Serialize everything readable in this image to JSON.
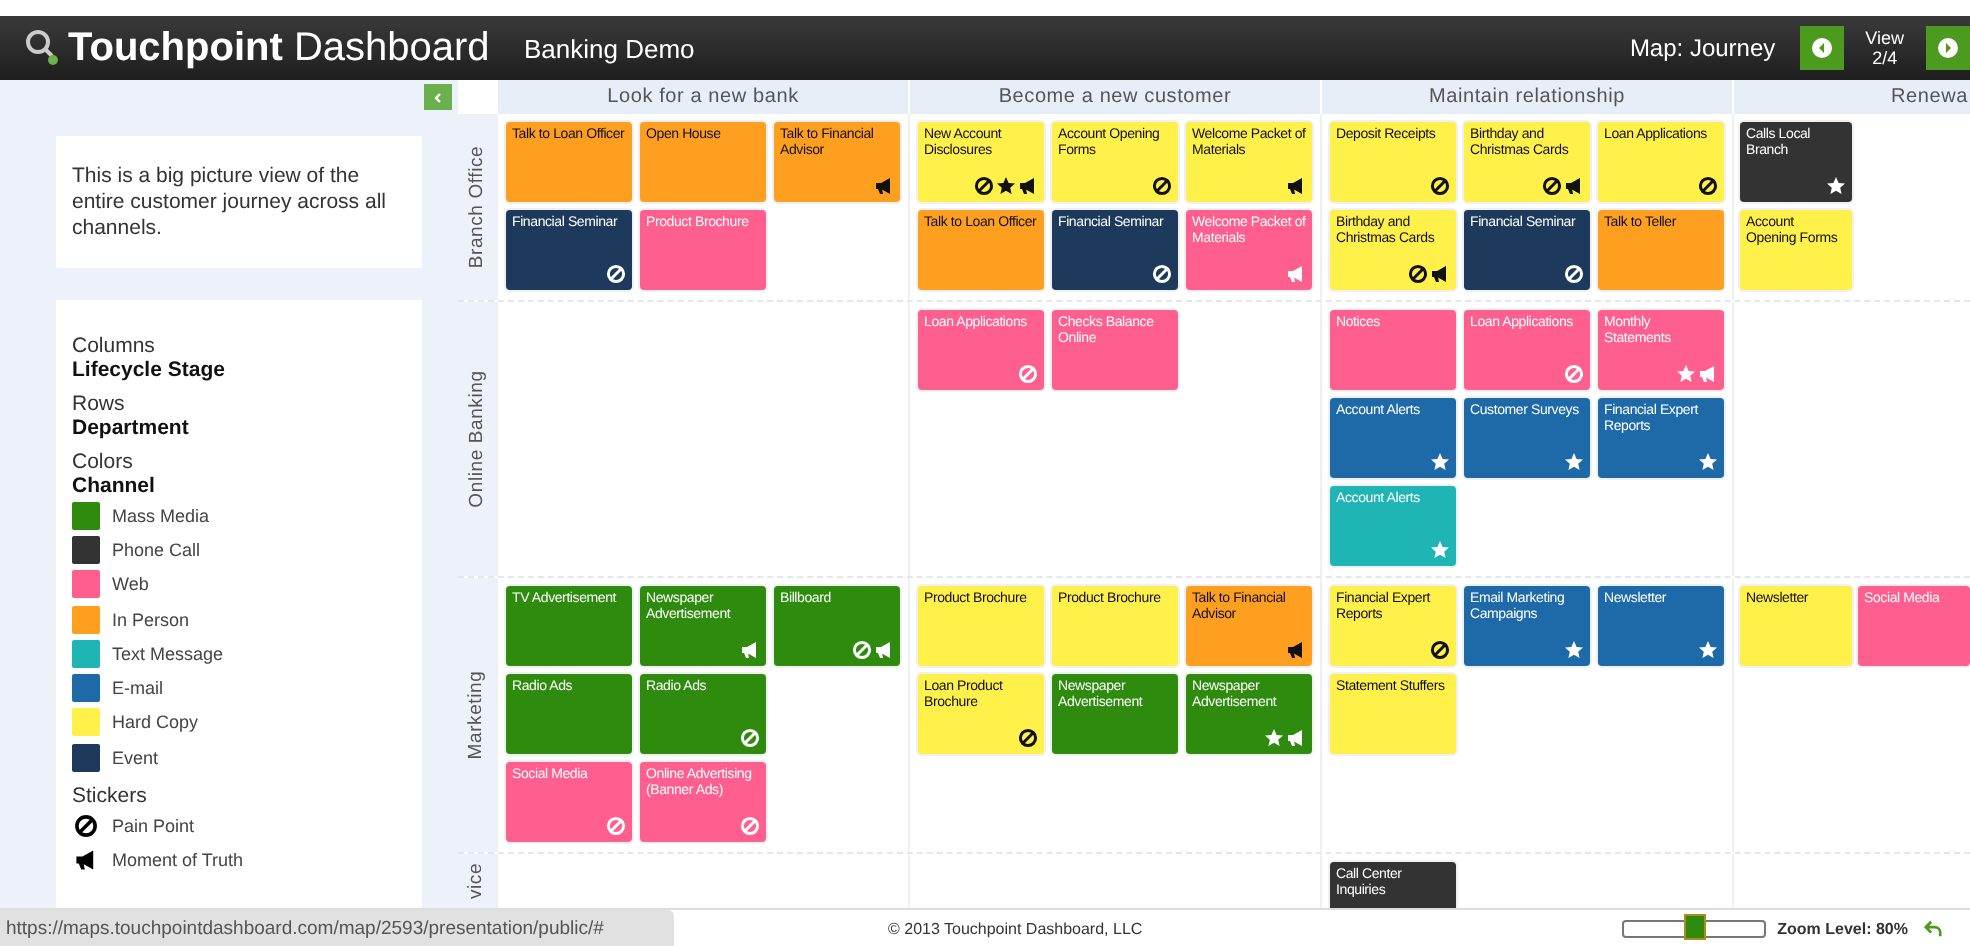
{
  "header": {
    "brand_bold": "Touchpoint",
    "brand_rest": "Dashboard",
    "map_name": "Banking Demo",
    "map_type": "Map: Journey",
    "view_label": "View",
    "view_count": "2/4"
  },
  "sidebar": {
    "description": "This is a big picture view of the entire customer journey across all channels.",
    "legend": [
      {
        "heading": "Columns",
        "value": "Lifecycle Stage"
      },
      {
        "heading": "Rows",
        "value": "Department"
      }
    ],
    "colors_heading": "Colors",
    "colors_value": "Channel",
    "channels": [
      {
        "label": "Mass Media",
        "color": "#2e8b0e"
      },
      {
        "label": "Phone Call",
        "color": "#333333"
      },
      {
        "label": "Web",
        "color": "#ff5f8f"
      },
      {
        "label": "In Person",
        "color": "#ff9f1f"
      },
      {
        "label": "Text Message",
        "color": "#1fb5b5"
      },
      {
        "label": "E-mail",
        "color": "#1e6aa8"
      },
      {
        "label": "Hard Copy",
        "color": "#fff04a"
      },
      {
        "label": "Event",
        "color": "#1d3a5c"
      }
    ],
    "stickers_heading": "Stickers",
    "stickers": [
      {
        "kind": "pain",
        "label": "Pain Point"
      },
      {
        "kind": "moment",
        "label": "Moment of Truth"
      }
    ]
  },
  "columns": [
    "Look for a new bank",
    "Become a new customer",
    "Maintain relationship",
    "Renewa"
  ],
  "rows": [
    {
      "label": "Branch Office",
      "cells": [
        {
          "kind": "cards",
          "cards": [
            {
              "kind": "card",
              "title": "Talk to Loan Officer",
              "color": "#ff9f1f"
            },
            {
              "kind": "card",
              "title": "Open House",
              "color": "#ff9f1f"
            },
            {
              "kind": "card",
              "title": "Talk to Financial Advisor",
              "color": "#ff9f1f",
              "stickers": [
                {
                  "kind": "moment"
                }
              ]
            },
            {
              "kind": "card",
              "title": "Financial Seminar",
              "color": "#1d3a5c",
              "stickers": [
                {
                  "kind": "pain"
                }
              ]
            },
            {
              "kind": "card",
              "title": "Product Brochure",
              "color": "#ff5f8f"
            }
          ]
        },
        {
          "kind": "cards",
          "cards": [
            {
              "kind": "card",
              "title": "New Account Disclosures",
              "color": "#fff04a",
              "stickers": [
                {
                  "kind": "pain"
                },
                {
                  "kind": "star"
                },
                {
                  "kind": "moment"
                }
              ]
            },
            {
              "kind": "card",
              "title": "Account Opening Forms",
              "color": "#fff04a",
              "stickers": [
                {
                  "kind": "pain"
                }
              ]
            },
            {
              "kind": "card",
              "title": "Welcome Packet of Materials",
              "color": "#fff04a",
              "stickers": [
                {
                  "kind": "moment"
                }
              ]
            },
            {
              "kind": "card",
              "title": "Talk to Loan Officer",
              "color": "#ff9f1f"
            },
            {
              "kind": "card",
              "title": "Financial Seminar",
              "color": "#1d3a5c",
              "stickers": [
                {
                  "kind": "pain"
                }
              ]
            },
            {
              "kind": "card",
              "title": "Welcome Packet of Materials",
              "color": "#ff5f8f",
              "stickers": [
                {
                  "kind": "moment"
                }
              ]
            }
          ]
        },
        {
          "kind": "cards",
          "cards": [
            {
              "kind": "card",
              "title": "Deposit Receipts",
              "color": "#fff04a",
              "stickers": [
                {
                  "kind": "pain"
                }
              ]
            },
            {
              "kind": "card",
              "title": "Birthday and Christmas Cards",
              "color": "#fff04a",
              "stickers": [
                {
                  "kind": "pain"
                },
                {
                  "kind": "moment"
                }
              ]
            },
            {
              "kind": "card",
              "title": "Loan Applications",
              "color": "#fff04a",
              "stickers": [
                {
                  "kind": "pain"
                }
              ]
            },
            {
              "kind": "card",
              "title": "Birthday and Christmas Cards",
              "color": "#fff04a",
              "stickers": [
                {
                  "kind": "pain"
                },
                {
                  "kind": "moment"
                }
              ]
            },
            {
              "kind": "card",
              "title": "Financial Seminar",
              "color": "#1d3a5c",
              "stickers": [
                {
                  "kind": "pain"
                }
              ]
            },
            {
              "kind": "card",
              "title": "Talk to Teller",
              "color": "#ff9f1f"
            }
          ]
        },
        {
          "kind": "cards",
          "cards": [
            {
              "kind": "card",
              "title": "Calls Local Branch",
              "color": "#333333",
              "stickers": [
                {
                  "kind": "star"
                }
              ]
            },
            {
              "kind": "gap"
            },
            {
              "kind": "card",
              "title": "Account Opening Forms",
              "color": "#fff04a"
            }
          ]
        }
      ]
    },
    {
      "label": "Online Banking",
      "cells": [
        {
          "kind": "empty"
        },
        {
          "kind": "cards",
          "cards": [
            {
              "kind": "card",
              "title": "Loan Applications",
              "color": "#ff5f8f",
              "stickers": [
                {
                  "kind": "pain"
                }
              ]
            },
            {
              "kind": "card",
              "title": "Checks Balance Online",
              "color": "#ff5f8f"
            }
          ]
        },
        {
          "kind": "cards",
          "cards": [
            {
              "kind": "card",
              "title": "Notices",
              "color": "#ff5f8f"
            },
            {
              "kind": "card",
              "title": "Loan Applications",
              "color": "#ff5f8f",
              "stickers": [
                {
                  "kind": "pain"
                }
              ]
            },
            {
              "kind": "card",
              "title": "Monthly Statements",
              "color": "#ff5f8f",
              "stickers": [
                {
                  "kind": "star"
                },
                {
                  "kind": "moment"
                }
              ]
            },
            {
              "kind": "card",
              "title": "Account Alerts",
              "color": "#1e6aa8",
              "stickers": [
                {
                  "kind": "star"
                }
              ]
            },
            {
              "kind": "card",
              "title": "Customer Surveys",
              "color": "#1e6aa8",
              "stickers": [
                {
                  "kind": "star"
                }
              ]
            },
            {
              "kind": "card",
              "title": "Financial Expert Reports",
              "color": "#1e6aa8",
              "stickers": [
                {
                  "kind": "star"
                }
              ]
            },
            {
              "kind": "card",
              "title": "Account Alerts",
              "color": "#1fb5b5",
              "stickers": [
                {
                  "kind": "star"
                }
              ]
            }
          ]
        },
        {
          "kind": "empty"
        }
      ]
    },
    {
      "label": "Marketing",
      "cells": [
        {
          "kind": "cards",
          "cards": [
            {
              "kind": "card",
              "title": "TV Advertisement",
              "color": "#2e8b0e"
            },
            {
              "kind": "card",
              "title": "Newspaper Advertisement",
              "color": "#2e8b0e",
              "stickers": [
                {
                  "kind": "moment"
                }
              ]
            },
            {
              "kind": "card",
              "title": "Billboard",
              "color": "#2e8b0e",
              "stickers": [
                {
                  "kind": "pain"
                },
                {
                  "kind": "moment"
                }
              ]
            },
            {
              "kind": "card",
              "title": "Radio Ads",
              "color": "#2e8b0e"
            },
            {
              "kind": "card",
              "title": "Radio Ads",
              "color": "#2e8b0e",
              "stickers": [
                {
                  "kind": "pain"
                }
              ]
            },
            {
              "kind": "gap"
            },
            {
              "kind": "card",
              "title": "Social Media",
              "color": "#ff5f8f",
              "stickers": [
                {
                  "kind": "pain"
                }
              ]
            },
            {
              "kind": "card",
              "title": "Online Advertising (Banner Ads)",
              "color": "#ff5f8f",
              "stickers": [
                {
                  "kind": "pain"
                }
              ]
            }
          ]
        },
        {
          "kind": "cards",
          "cards": [
            {
              "kind": "card",
              "title": "Product Brochure",
              "color": "#fff04a"
            },
            {
              "kind": "card",
              "title": "Product Brochure",
              "color": "#fff04a"
            },
            {
              "kind": "card",
              "title": "Talk to Financial Advisor",
              "color": "#ff9f1f",
              "stickers": [
                {
                  "kind": "moment"
                }
              ]
            },
            {
              "kind": "card",
              "title": "Loan Product Brochure",
              "color": "#fff04a",
              "stickers": [
                {
                  "kind": "pain"
                }
              ]
            },
            {
              "kind": "card",
              "title": "Newspaper Advertisement",
              "color": "#2e8b0e"
            },
            {
              "kind": "card",
              "title": "Newspaper Advertisement",
              "color": "#2e8b0e",
              "stickers": [
                {
                  "kind": "star"
                },
                {
                  "kind": "moment"
                }
              ]
            }
          ]
        },
        {
          "kind": "cards",
          "cards": [
            {
              "kind": "card",
              "title": "Financial Expert Reports",
              "color": "#fff04a",
              "stickers": [
                {
                  "kind": "pain"
                }
              ]
            },
            {
              "kind": "card",
              "title": "Email Marketing Campaigns",
              "color": "#1e6aa8",
              "stickers": [
                {
                  "kind": "star"
                }
              ]
            },
            {
              "kind": "card",
              "title": "Newsletter",
              "color": "#1e6aa8",
              "stickers": [
                {
                  "kind": "star"
                }
              ]
            },
            {
              "kind": "card",
              "title": "Statement Stuffers",
              "color": "#fff04a"
            }
          ]
        },
        {
          "kind": "cards",
          "cards": [
            {
              "kind": "card",
              "title": "Newsletter",
              "color": "#fff04a"
            },
            {
              "kind": "card",
              "title": "Social Media",
              "color": "#ff5f8f"
            }
          ]
        }
      ]
    },
    {
      "label": "vice",
      "cells": [
        {
          "kind": "empty"
        },
        {
          "kind": "empty"
        },
        {
          "kind": "cards",
          "cards": [
            {
              "kind": "card",
              "title": "Call Center Inquiries",
              "color": "#333333"
            }
          ]
        },
        {
          "kind": "empty"
        }
      ]
    }
  ],
  "footer": {
    "url": "https://maps.touchpointdashboard.com/map/2593/presentation/public/#",
    "copyright": "© 2013 Touchpoint Dashboard, LLC",
    "zoom": {
      "level": 0.5,
      "label": "Zoom Level: 80%"
    }
  }
}
